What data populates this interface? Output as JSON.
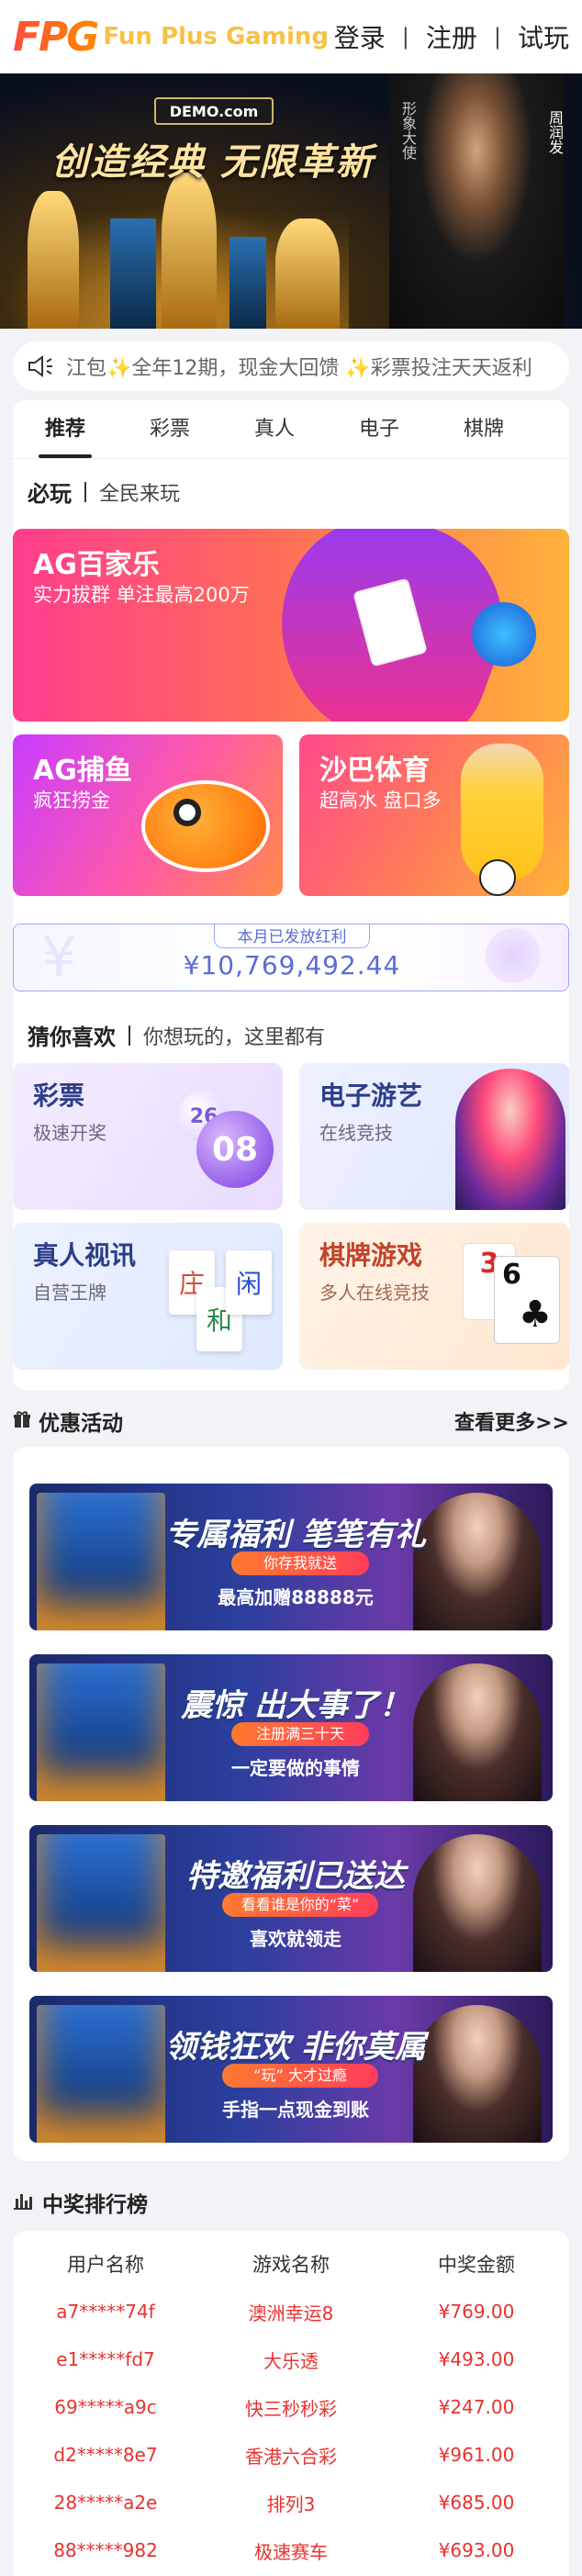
{
  "header": {
    "logo_mark": "FPG",
    "logo_text": "Fun Plus Gaming",
    "login": "登录",
    "register": "注册",
    "trial": "试玩",
    "separator": "|"
  },
  "banner": {
    "site": "DEMO.com",
    "slogan": "创造经典 无限革新",
    "badge_text": "形象大使",
    "name_text": "周润发"
  },
  "notice": {
    "icon": "speaker-icon",
    "text": "江包✨全年12期，现金大回馈 ✨彩票投注天天返利"
  },
  "tabs": [
    "推荐",
    "彩票",
    "真人",
    "电子",
    "棋牌"
  ],
  "active_tab": "推荐",
  "section_must": {
    "title": "必玩",
    "sub": "全民来玩"
  },
  "cards_top": [
    {
      "title": "AG百家乐",
      "sub": "实力拔群 单注最高200万"
    },
    {
      "title": "AG捕鱼",
      "sub": "疯狂捞金"
    },
    {
      "title": "沙巴体育",
      "sub": "超高水 盘口多"
    }
  ],
  "bonus": {
    "label": "本月已发放红利",
    "value": "¥10,769,492.44"
  },
  "section_like": {
    "title": "猜你喜欢",
    "sub": "你想玩的，这里都有"
  },
  "cards_like": [
    {
      "title": "彩票",
      "sub": "极速开奖",
      "ball1": "26",
      "ball2": "08"
    },
    {
      "title": "电子游艺",
      "sub": "在线竞技"
    },
    {
      "title": "真人视讯",
      "sub": "自营王牌",
      "chars": [
        "庄",
        "和",
        "闲"
      ]
    },
    {
      "title": "棋牌游戏",
      "sub": "多人在线竞技",
      "card1": "3",
      "card2": "6",
      "suit": "♣"
    }
  ],
  "promotions": {
    "title": "优惠活动",
    "more": "查看更多>>",
    "items": [
      {
        "title": "专属福利 笔笔有礼",
        "tag": "你存我就送",
        "line": "最高加赠88888元"
      },
      {
        "title": "震惊 出大事了！",
        "tag": "注册满三十天",
        "line": "一定要做的事情"
      },
      {
        "title": "特邀福利已送达",
        "tag": "看看谁是你的“菜”",
        "line": "喜欢就领走"
      },
      {
        "title": "领钱狂欢 非你莫属",
        "tag": "“玩” 大才过瘾",
        "line": "手指一点现金到账"
      }
    ]
  },
  "ranking": {
    "title": "中奖排行榜",
    "columns": [
      "用户名称",
      "游戏名称",
      "中奖金额"
    ],
    "rows": [
      [
        "a7*****74f",
        "澳洲幸运8",
        "¥769.00"
      ],
      [
        "e1*****fd7",
        "大乐透",
        "¥493.00"
      ],
      [
        "69*****a9c",
        "快三秒秒彩",
        "¥247.00"
      ],
      [
        "d2*****8e7",
        "香港六合彩",
        "¥961.00"
      ],
      [
        "28*****a2e",
        "排列3",
        "¥685.00"
      ],
      [
        "88*****982",
        "极速赛车",
        "¥693.00"
      ]
    ]
  },
  "colors": {
    "accent": "#5a6cd6",
    "win_red": "#e8322f",
    "logo_gold": "#f6c146"
  }
}
